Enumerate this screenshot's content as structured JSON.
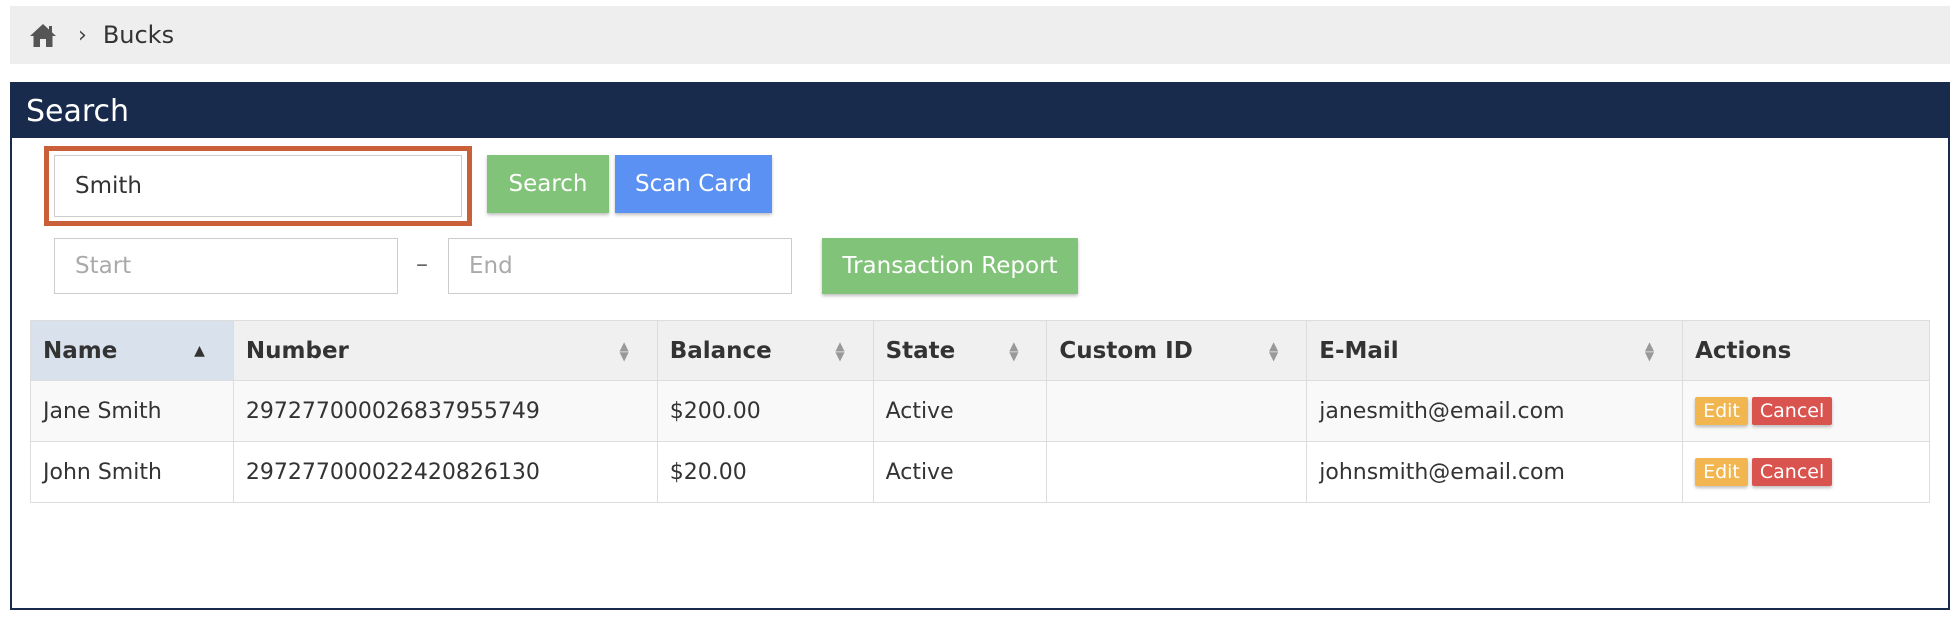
{
  "breadcrumb": {
    "home_icon": "home-icon",
    "separator": "›",
    "current": "Bucks"
  },
  "panel": {
    "title": "Search"
  },
  "search": {
    "value": "Smith",
    "search_label": "Search",
    "scan_label": "Scan Card"
  },
  "date_range": {
    "start_placeholder": "Start",
    "separator": "–",
    "end_placeholder": "End",
    "report_label": "Transaction Report"
  },
  "table": {
    "columns": [
      "Name",
      "Number",
      "Balance",
      "State",
      "Custom ID",
      "E-Mail",
      "Actions"
    ],
    "sorted_column": "Name",
    "sort_direction": "ascending",
    "rows": [
      {
        "name": "Jane Smith",
        "number": "297277000026837955749",
        "balance": "$200.00",
        "state": "Active",
        "custom_id": "",
        "email": "janesmith@email.com",
        "edit": "Edit",
        "cancel": "Cancel"
      },
      {
        "name": "John Smith",
        "number": "297277000022420826130",
        "balance": "$20.00",
        "state": "Active",
        "custom_id": "",
        "email": "johnsmith@email.com",
        "edit": "Edit",
        "cancel": "Cancel"
      }
    ]
  },
  "colors": {
    "header_navy": "#192b4d",
    "search_highlight": "#c9603a",
    "green_button": "#82c37a",
    "blue_button": "#5a91f2",
    "edit_orange": "#f1b64f",
    "cancel_red": "#d9534f"
  }
}
